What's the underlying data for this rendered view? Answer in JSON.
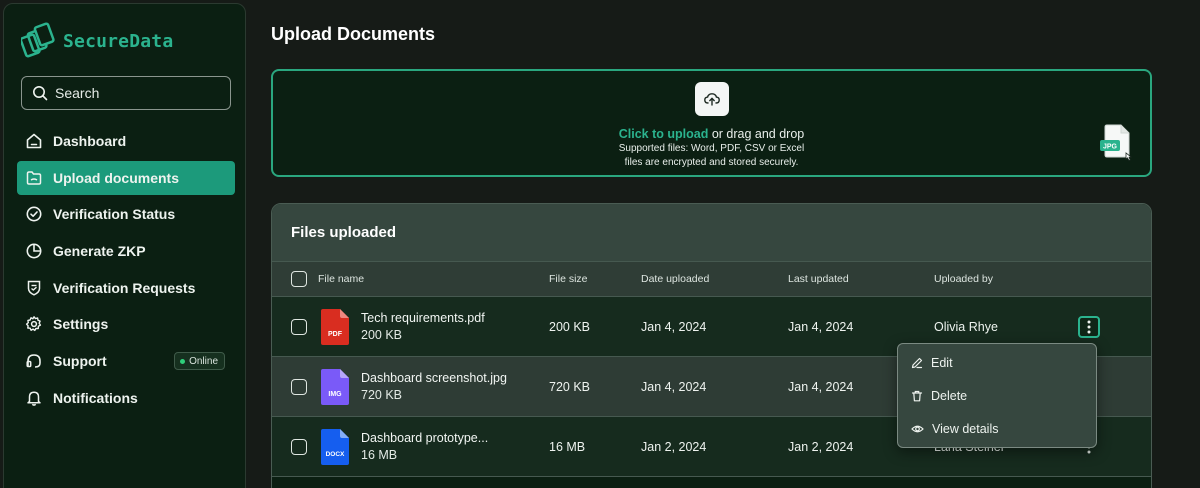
{
  "brand": {
    "name": "SecureData",
    "accent": "#2bb38e"
  },
  "search": {
    "placeholder": "Search"
  },
  "sidebar": {
    "items": [
      {
        "label": "Dashboard",
        "icon": "home-icon",
        "active": false
      },
      {
        "label": "Upload documents",
        "icon": "folder-upload-icon",
        "active": true
      },
      {
        "label": "Verification Status",
        "icon": "check-circle-icon",
        "active": false
      },
      {
        "label": "Generate ZKP",
        "icon": "pie-chart-icon",
        "active": false
      },
      {
        "label": "Verification Requests",
        "icon": "shield-file-icon",
        "active": false
      },
      {
        "label": "Settings",
        "icon": "gear-icon",
        "active": false
      },
      {
        "label": "Support",
        "icon": "support-icon",
        "active": false,
        "badge": "Online"
      },
      {
        "label": "Notifications",
        "icon": "bell-icon",
        "active": false
      }
    ]
  },
  "page": {
    "title": "Upload Documents"
  },
  "dropzone": {
    "link_text": "Click to upload",
    "rest_text": " or drag and drop",
    "line2": "Supported files: Word, PDF, CSV or Excel",
    "line3": "files are encrypted and stored securely.",
    "drag_file_label": "JPG"
  },
  "files": {
    "title": "Files uploaded",
    "columns": {
      "name": "File name",
      "size": "File size",
      "date_uploaded": "Date uploaded",
      "last_updated": "Last updated",
      "uploaded_by": "Uploaded by"
    },
    "rows": [
      {
        "name": "Tech requirements.pdf",
        "sub": "200 KB",
        "size": "200 KB",
        "date_uploaded": "Jan 4, 2024",
        "last_updated": "Jan 4, 2024",
        "uploaded_by": "Olivia Rhye",
        "type": "PDF",
        "type_color": "#d92d20"
      },
      {
        "name": "Dashboard screenshot.jpg",
        "sub": "720 KB",
        "size": "720 KB",
        "date_uploaded": "Jan 4, 2024",
        "last_updated": "Jan 4, 2024",
        "uploaded_by": "",
        "type": "IMG",
        "type_color": "#7a5af8"
      },
      {
        "name": "Dashboard prototype...",
        "sub": "16 MB",
        "size": "16 MB",
        "date_uploaded": "Jan 2, 2024",
        "last_updated": "Jan 2, 2024",
        "uploaded_by": "Lana Steiner",
        "type": "DOCX",
        "type_color": "#155eef"
      }
    ]
  },
  "context_menu": {
    "items": [
      {
        "label": "Edit",
        "icon": "pencil-icon"
      },
      {
        "label": "Delete",
        "icon": "trash-icon"
      },
      {
        "label": "View details",
        "icon": "eye-icon"
      }
    ]
  }
}
